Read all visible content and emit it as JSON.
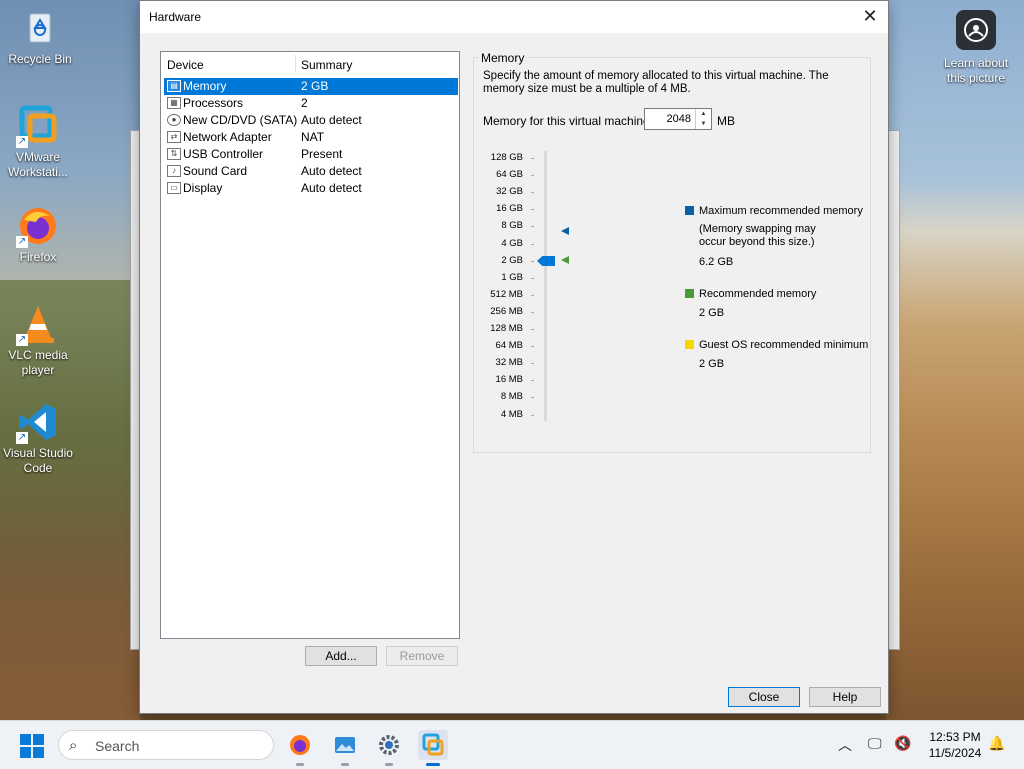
{
  "window": {
    "title": "Hardware"
  },
  "device_list": {
    "headers": {
      "device": "Device",
      "summary": "Summary"
    },
    "rows": [
      {
        "device": "Memory",
        "summary": "2 GB",
        "icon": "memory-icon",
        "selected": true
      },
      {
        "device": "Processors",
        "summary": "2",
        "icon": "processor-icon",
        "selected": false
      },
      {
        "device": "New CD/DVD (SATA)",
        "summary": "Auto detect",
        "icon": "cd-dvd-icon",
        "selected": false
      },
      {
        "device": "Network Adapter",
        "summary": "NAT",
        "icon": "network-adapter-icon",
        "selected": false
      },
      {
        "device": "USB Controller",
        "summary": "Present",
        "icon": "usb-icon",
        "selected": false
      },
      {
        "device": "Sound Card",
        "summary": "Auto detect",
        "icon": "sound-icon",
        "selected": false
      },
      {
        "device": "Display",
        "summary": "Auto detect",
        "icon": "display-icon",
        "selected": false
      }
    ],
    "add_label": "Add...",
    "remove_label": "Remove"
  },
  "memory": {
    "group_label": "Memory",
    "description": "Specify the amount of memory allocated to this virtual machine. The memory size must be a multiple of 4 MB.",
    "field_label": "Memory for this virtual machine:",
    "value": "2048",
    "unit": "MB",
    "scale": [
      "128 GB",
      "64 GB",
      "32 GB",
      "16 GB",
      "8 GB",
      "4 GB",
      "2 GB",
      "1 GB",
      "512 MB",
      "256 MB",
      "128 MB",
      "64 MB",
      "32 MB",
      "16 MB",
      "8 MB",
      "4 MB"
    ],
    "legend": {
      "max_label": "Maximum recommended memory",
      "max_note": "(Memory swapping may occur beyond this size.)",
      "max_value": "6.2 GB",
      "rec_label": "Recommended memory",
      "rec_value": "2 GB",
      "min_label": "Guest OS recommended minimum",
      "min_value": "2 GB"
    },
    "colors": {
      "max": "#0a60a8",
      "recommended": "#4a9a3a",
      "minimum": "#f5d800",
      "slider": "#0078d7"
    }
  },
  "footer": {
    "close_label": "Close",
    "help_label": "Help"
  },
  "desktop": {
    "icons": [
      {
        "label": "Recycle Bin",
        "icon": "recycle-bin-icon"
      },
      {
        "label": "VMware Workstati...",
        "icon": "vmware-icon"
      },
      {
        "label": "Firefox",
        "icon": "firefox-icon"
      },
      {
        "label": "VLC media player",
        "icon": "vlc-icon"
      },
      {
        "label": "Visual Studio Code",
        "icon": "vscode-icon"
      }
    ],
    "learn_label": "Learn about this picture"
  },
  "taskbar": {
    "search_placeholder": "Search",
    "time": "12:53 PM",
    "date": "11/5/2024"
  }
}
